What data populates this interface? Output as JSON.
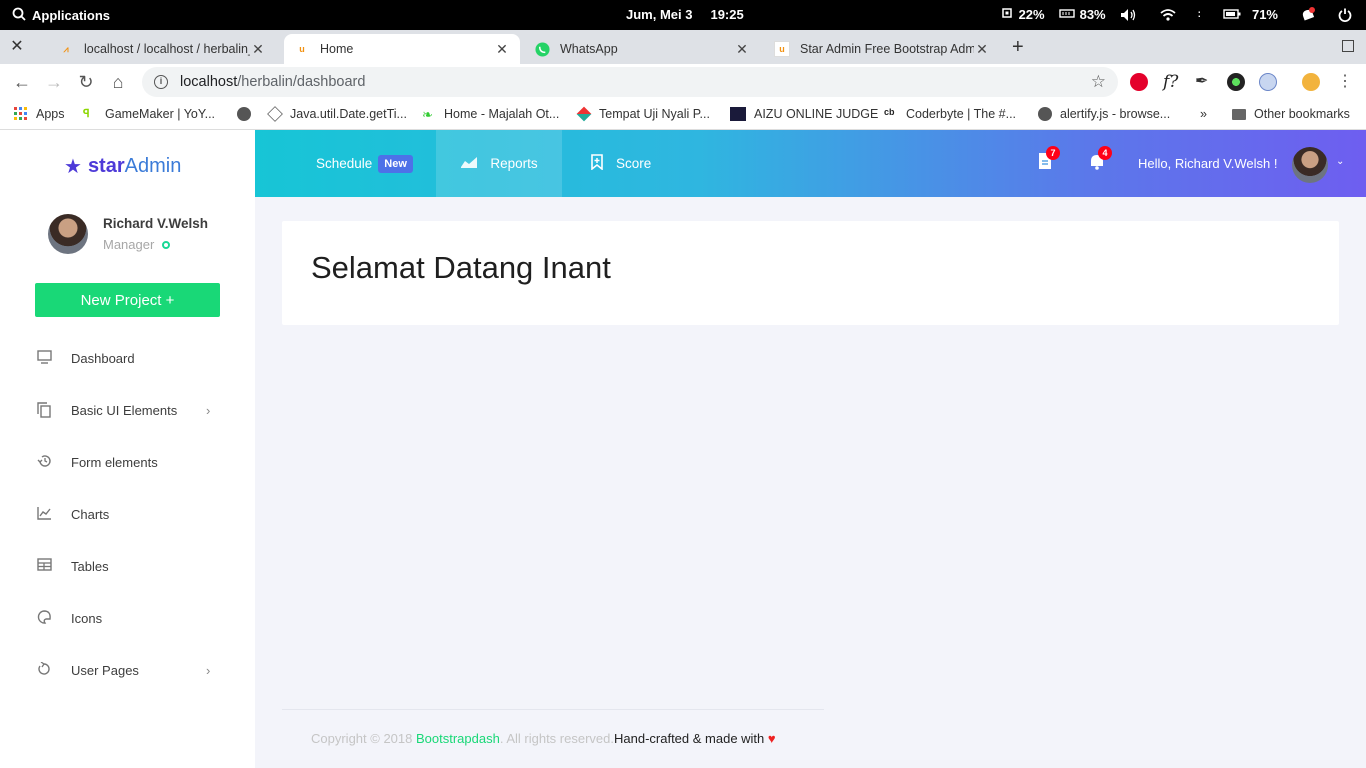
{
  "os": {
    "applications_label": "Applications",
    "date": "Jum, Mei  3",
    "time": "19:25",
    "cpu": "22%",
    "memory": "83%",
    "battery": "71%"
  },
  "tabs": [
    {
      "title": "localhost / localhost / herbalin_",
      "active": false
    },
    {
      "title": "Home",
      "active": true
    },
    {
      "title": "WhatsApp",
      "active": false
    },
    {
      "title": "Star Admin Free Bootstrap Adm",
      "active": false
    }
  ],
  "address": {
    "host": "localhost",
    "path": "/herbalin/dashboard"
  },
  "bookmarks": [
    {
      "label": "Apps"
    },
    {
      "label": "GameMaker | YoY..."
    },
    {
      "label": "Java.util.Date.getTi..."
    },
    {
      "label": "Home - Majalah Ot..."
    },
    {
      "label": "Tempat Uji Nyali P..."
    },
    {
      "label": "AIZU ONLINE JUDGE"
    },
    {
      "label": "Coderbyte | The #..."
    },
    {
      "label": "alertify.js - browse..."
    },
    {
      "label": "Other bookmarks"
    }
  ],
  "bookmarks_more": "»",
  "sidebar": {
    "brand_star": "star",
    "brand_admin": "Admin",
    "user_name": "Richard V.Welsh",
    "user_role": "Manager",
    "new_project": "New Project  +",
    "items": [
      {
        "label": "Dashboard",
        "icon": "monitor-icon",
        "expand": false
      },
      {
        "label": "Basic UI Elements",
        "icon": "copy-icon",
        "expand": true
      },
      {
        "label": "Form elements",
        "icon": "restore-icon",
        "expand": false
      },
      {
        "label": "Charts",
        "icon": "line-chart-icon",
        "expand": false
      },
      {
        "label": "Tables",
        "icon": "table-icon",
        "expand": false
      },
      {
        "label": "Icons",
        "icon": "palette-icon",
        "expand": false
      },
      {
        "label": "User Pages",
        "icon": "reload-icon",
        "expand": true
      }
    ]
  },
  "topnav": {
    "schedule": "Schedule",
    "new_badge": "New",
    "reports": "Reports",
    "score": "Score",
    "messages_count": "7",
    "notifications_count": "4",
    "greeting": "Hello, Richard V.Welsh !"
  },
  "main": {
    "heading": "Selamat Datang Inant"
  },
  "footer": {
    "copyright": "Copyright © 2018 ",
    "link": "Bootstrapdash",
    "rights": ". All rights reserved.",
    "crafted": "Hand-crafted & made with ",
    "heart": "♥"
  },
  "colors": {
    "accent_green": "#19d877",
    "brand_purple": "#4d3ad8",
    "badge_red": "#ff0017"
  }
}
